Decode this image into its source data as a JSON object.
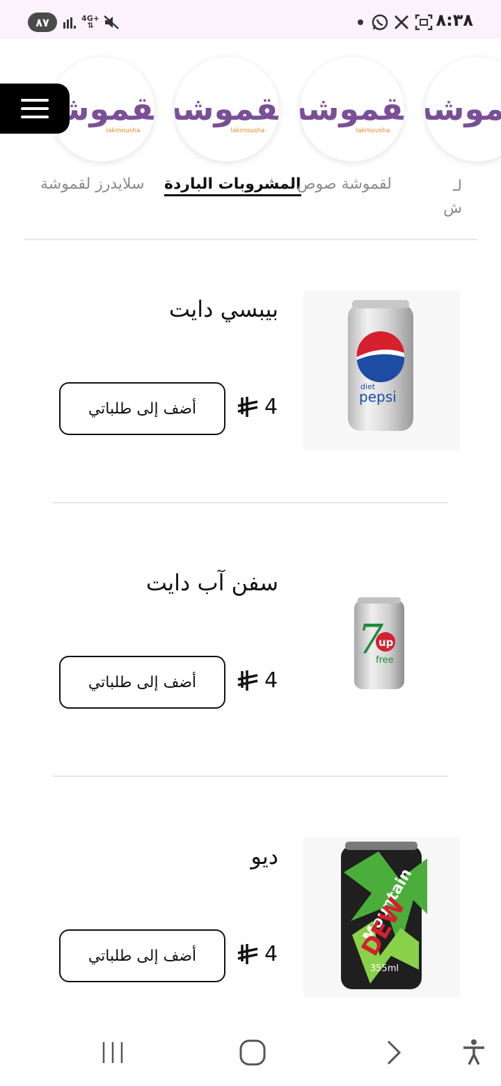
{
  "status_bar": {
    "battery": "٨٧",
    "network": "4G+",
    "time": "٨:٣٨",
    "icons": [
      "signal-icon",
      "mute-icon",
      "whatsapp-icon",
      "x-icon",
      "screenshot-icon",
      "dot-icon"
    ]
  },
  "categories": [
    {
      "label": "سلايدرز لقموشة",
      "logo_text": "لقموشه",
      "logo_sub": "lakmousha",
      "active": false
    },
    {
      "label": "المشروبات الباردة",
      "logo_text": "لقموشه",
      "logo_sub": "lakmousha",
      "active": true
    },
    {
      "label": "لقموشة صوص",
      "logo_text": "لقموشه",
      "logo_sub": "lakmousha",
      "active": false
    },
    {
      "label": "لـ ش",
      "logo_text": "لقموشه",
      "logo_sub": "lakmousha",
      "active": false
    }
  ],
  "products": [
    {
      "name": "بيبسي دايت",
      "price": "4",
      "add_label": "أضف إلى طلباتي",
      "image": "diet-pepsi-can"
    },
    {
      "name": "سفن آب دايت",
      "price": "4",
      "add_label": "أضف إلى طلباتي",
      "image": "7up-free-can"
    },
    {
      "name": "ديو",
      "price": "4",
      "add_label": "أضف إلى طلباتي",
      "image": "mountain-dew-can"
    }
  ],
  "colors": {
    "status_bg": "#fbf2fb",
    "logo_purple": "#7a4f96",
    "logo_orange": "#e58a2b",
    "active_text": "#111111"
  },
  "nav": [
    "recents-button",
    "home-button",
    "back-button",
    "accessibility-button"
  ]
}
